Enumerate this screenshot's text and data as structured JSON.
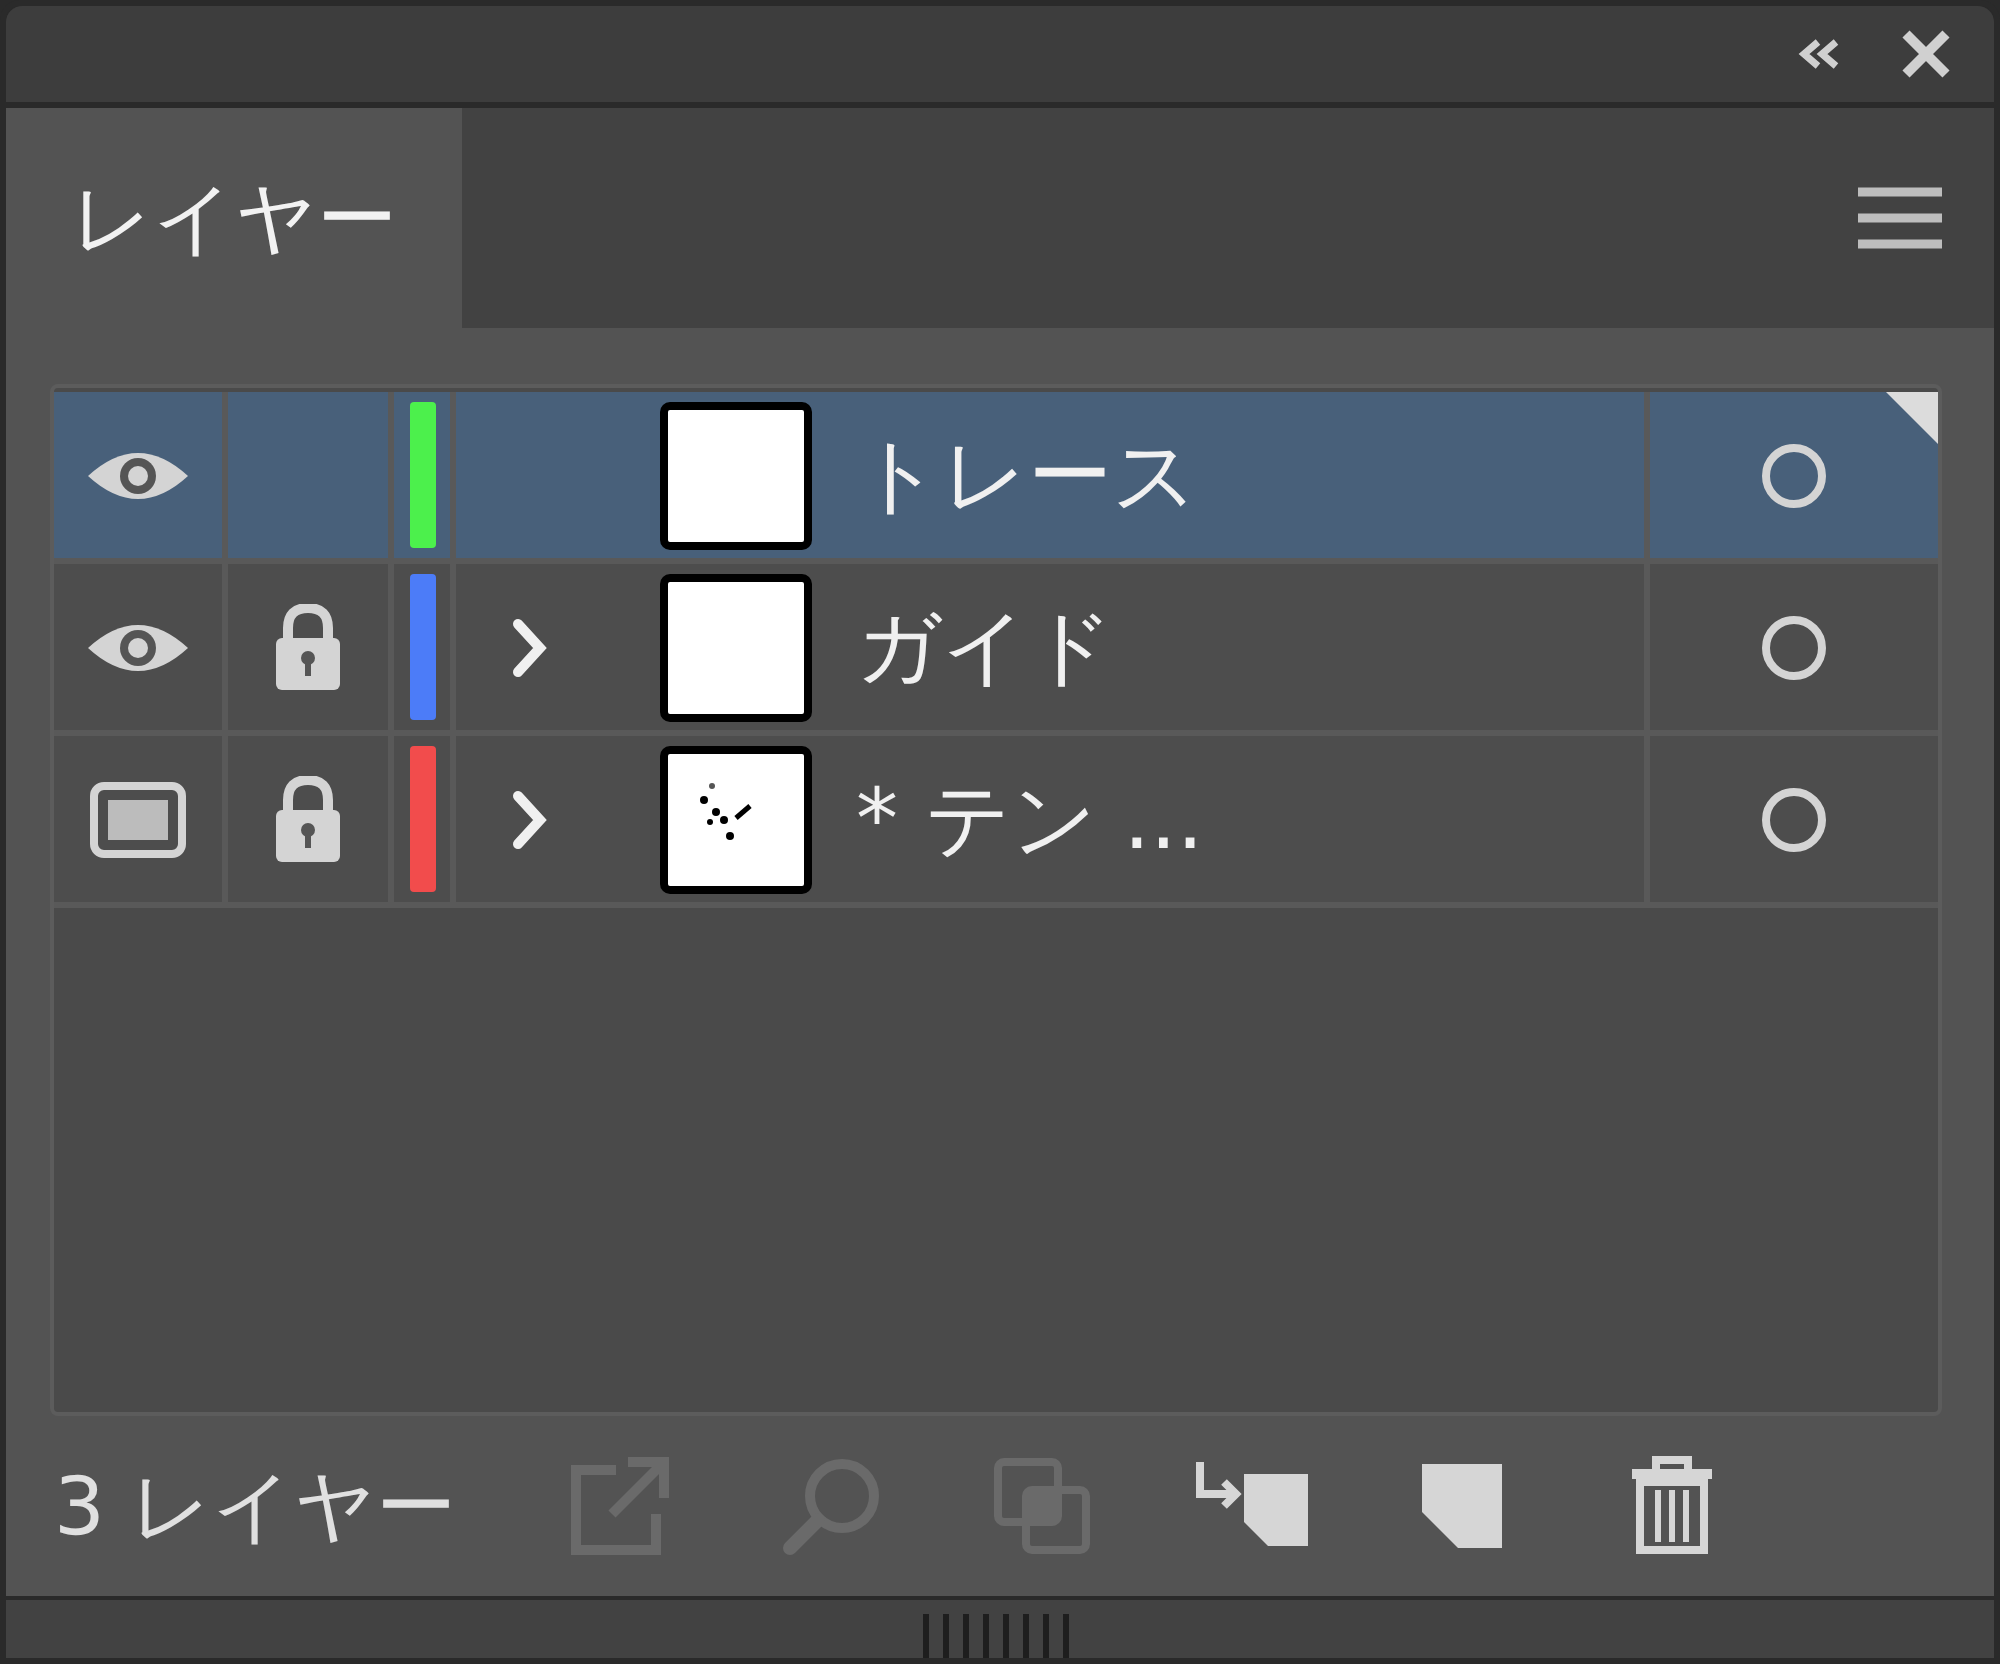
{
  "panel": {
    "tab": {
      "label": "レイヤー",
      "selected": true
    }
  },
  "layers": [
    {
      "name": "トレース",
      "selected": true,
      "outline_view": false,
      "locked": false,
      "expandable": false,
      "color": "#4cf04c",
      "thumbnail_art": false
    },
    {
      "name": "ガイド",
      "selected": false,
      "outline_view": false,
      "locked": true,
      "expandable": true,
      "color": "#4c7cf8",
      "thumbnail_art": false
    },
    {
      "name": "* テン ...",
      "selected": false,
      "outline_view": true,
      "locked": true,
      "expandable": true,
      "color": "#f24c4c",
      "thumbnail_art": true
    }
  ],
  "footer": {
    "count": "3 レイヤー",
    "buttons": [
      {
        "kind": "export",
        "disabled": true
      },
      {
        "kind": "locate",
        "disabled": true
      },
      {
        "kind": "collect",
        "disabled": true
      },
      {
        "kind": "clip",
        "disabled": false
      },
      {
        "kind": "new",
        "disabled": false
      },
      {
        "kind": "delete",
        "disabled": false
      }
    ]
  }
}
